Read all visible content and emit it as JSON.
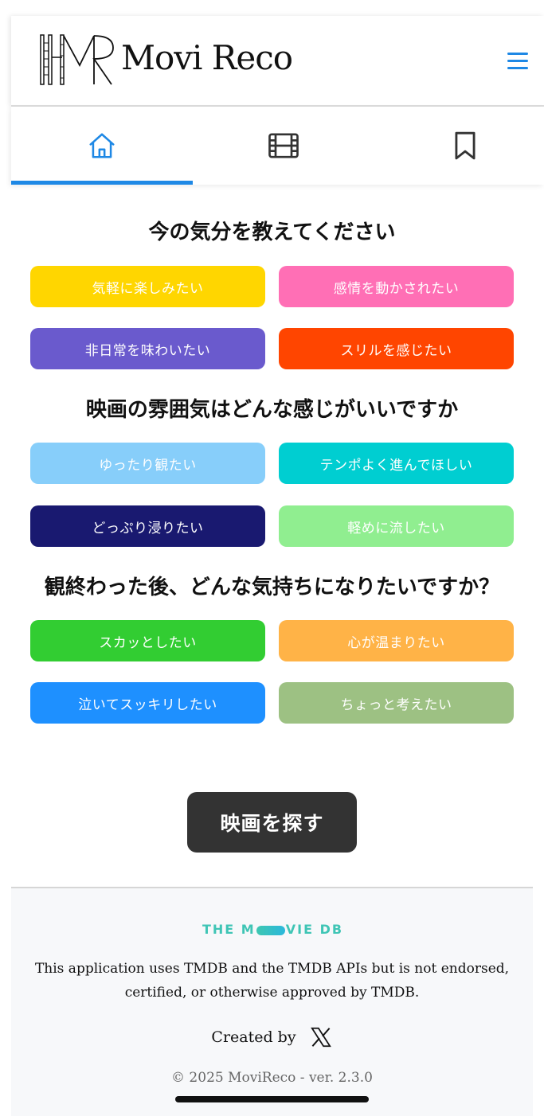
{
  "app": {
    "name": "Movi Reco"
  },
  "tabs": [
    {
      "icon": "home-icon",
      "active": true
    },
    {
      "icon": "film-icon",
      "active": false
    },
    {
      "icon": "bookmark-icon",
      "active": false
    }
  ],
  "colors": {
    "accent": "#1e88e5",
    "search_button": "#333333"
  },
  "sections": [
    {
      "title": "今の気分を教えてください",
      "options": [
        {
          "label": "気軽に楽しみたい",
          "color": "#FFD600"
        },
        {
          "label": "感情を動かされたい",
          "color": "#FF6FB5"
        },
        {
          "label": "非日常を味わいたい",
          "color": "#6A5ACD"
        },
        {
          "label": "スリルを感じたい",
          "color": "#FF4500"
        }
      ]
    },
    {
      "title": "映画の雰囲気はどんな感じがいいですか",
      "options": [
        {
          "label": "ゆったり観たい",
          "color": "#87CEFA"
        },
        {
          "label": "テンポよく進んでほしい",
          "color": "#00CED1"
        },
        {
          "label": "どっぷり浸りたい",
          "color": "#191970"
        },
        {
          "label": "軽めに流したい",
          "color": "#90EE90"
        }
      ]
    },
    {
      "title": "観終わった後、どんな気持ちになりたいですか？",
      "options": [
        {
          "label": "スカッとしたい",
          "color": "#32CD32"
        },
        {
          "label": "心が温まりたい",
          "color": "#FFB347"
        },
        {
          "label": "泣いてスッキリしたい",
          "color": "#1E90FF"
        },
        {
          "label": "ちょっと考えたい",
          "color": "#9DC183"
        }
      ]
    }
  ],
  "search_button": {
    "label": "映画を探す"
  },
  "footer": {
    "tmdb_logo_left": "THE M",
    "tmdb_logo_right": "VIE DB",
    "note": "This application uses TMDB and the TMDB APIs but is not endorsed, certified, or otherwise approved by TMDB.",
    "created_by": "Created by",
    "copyright": "© 2025 MoviReco - ver. 2.3.0"
  }
}
